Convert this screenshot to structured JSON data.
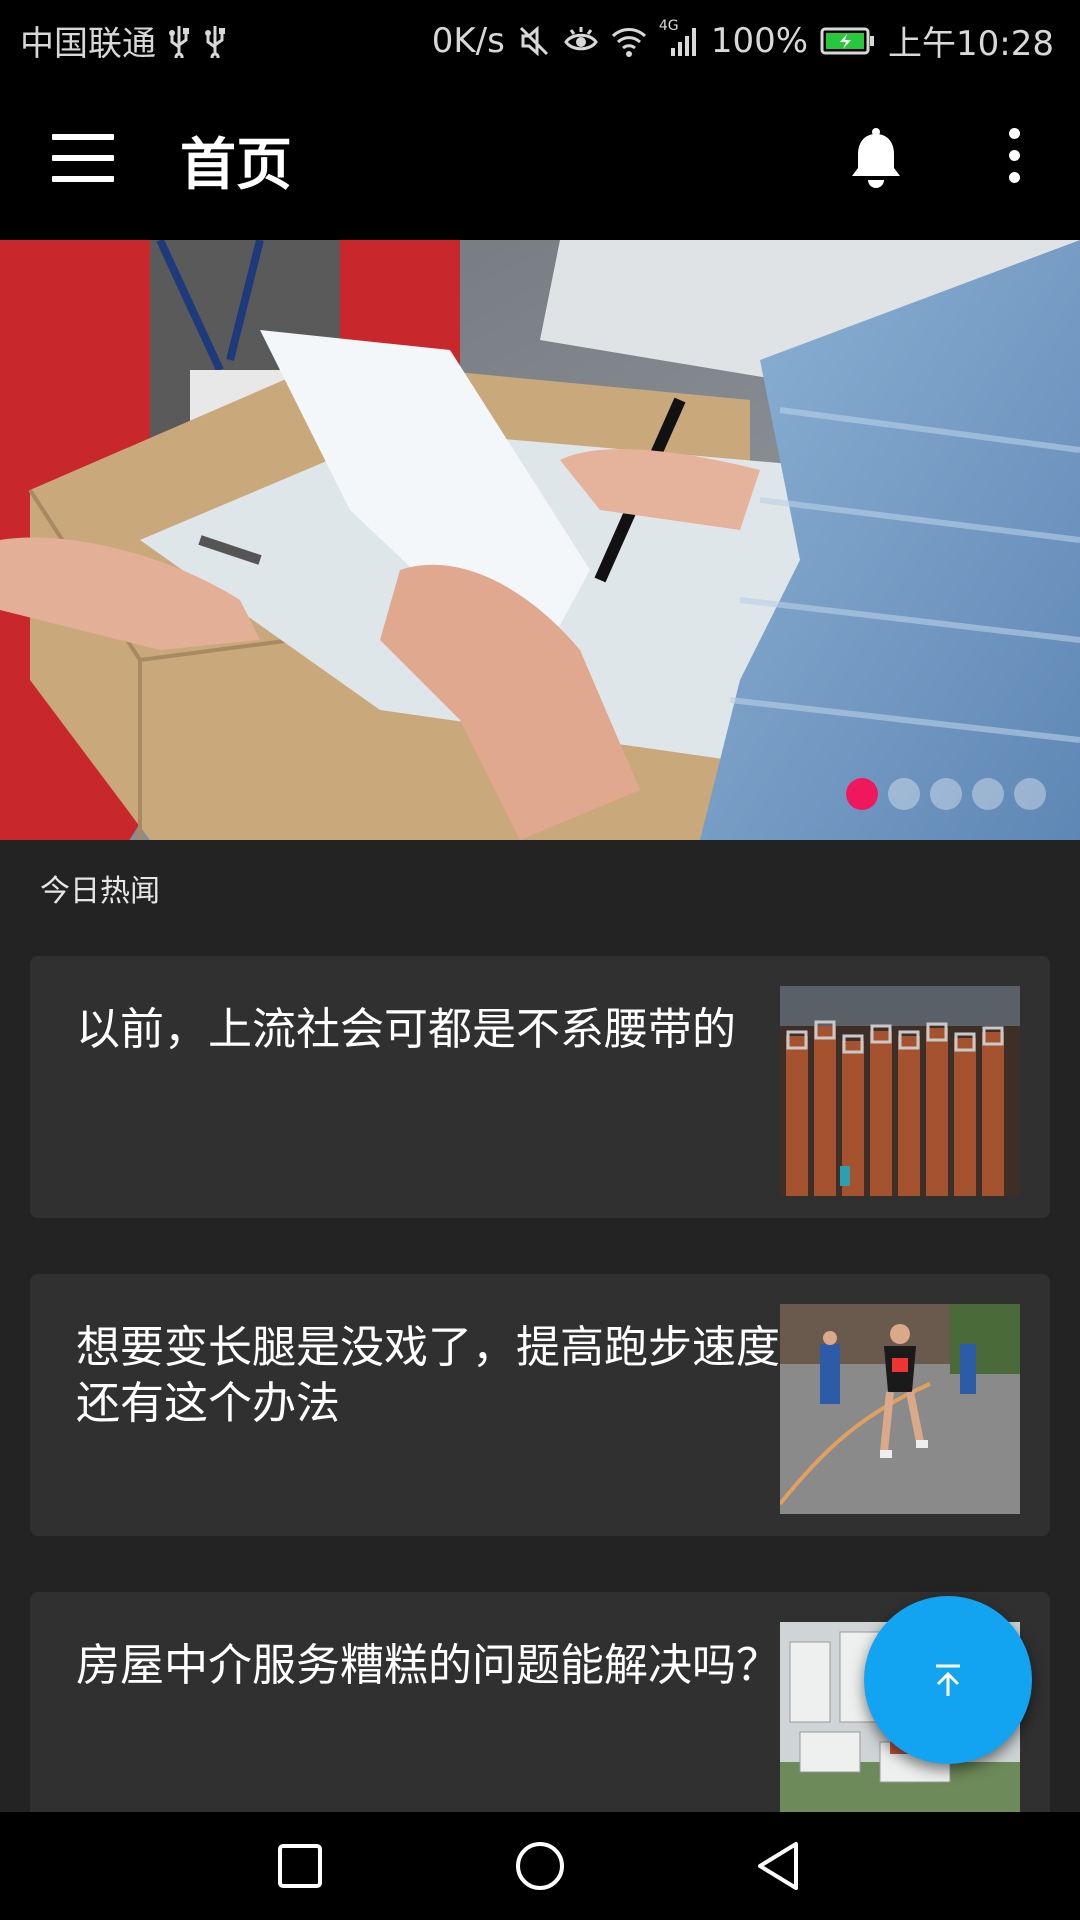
{
  "status_bar": {
    "carrier": "中国联通",
    "net_speed": "0K/s",
    "network_type": "4G",
    "battery": "100%",
    "time": "上午10:28"
  },
  "app_bar": {
    "title": "首页"
  },
  "banner": {
    "page_count": 5,
    "active_page": 1
  },
  "section": {
    "label": "今日热闻"
  },
  "news": [
    {
      "title": "以前，上流社会可都是不系腰带的"
    },
    {
      "title": "想要变长腿是没戏了，提高跑步速度还有这个办法"
    },
    {
      "title": "房屋中介服务糟糕的问题能解决吗？"
    }
  ],
  "colors": {
    "accent_dot": "#f0185c",
    "fab": "#12a4f0",
    "card_bg": "#303030",
    "page_bg": "#232323"
  }
}
